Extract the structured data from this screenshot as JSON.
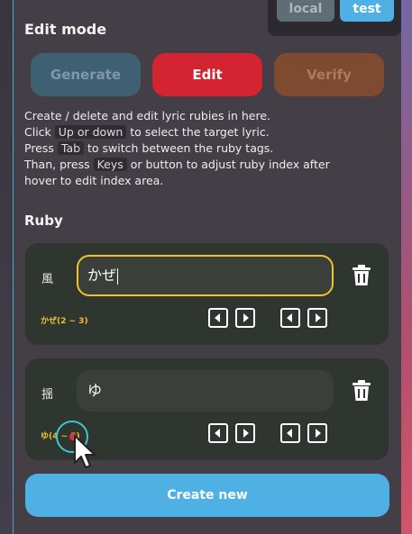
{
  "env": {
    "local_label": "local",
    "test_label": "test"
  },
  "panel": {
    "title": "Edit mode",
    "modes": {
      "generate": "Generate",
      "edit": "Edit",
      "verify": "Verify"
    },
    "description": {
      "l1": "Create / delete and edit lyric rubies in here.",
      "l2_pre": "Click ",
      "l2_key": "Up or down",
      "l2_post": " to select the target lyric.",
      "l3_pre": "Press ",
      "l3_key": "Tab",
      "l3_post": " to switch between the ruby tags.",
      "l4_pre": "Than, press ",
      "l4_key": "Keys",
      "l4_post": " or button to adjust ruby index after",
      "l5": "hover to edit index area."
    },
    "section_title": "Ruby",
    "rubies": [
      {
        "lyric": "風",
        "ruby": "かぜ",
        "index": "かぜ(2 ~ 3)"
      },
      {
        "lyric": "揺",
        "ruby": "ゆ",
        "index": "ゆ(4 ~ 5)"
      }
    ],
    "create_label": "Create new"
  }
}
